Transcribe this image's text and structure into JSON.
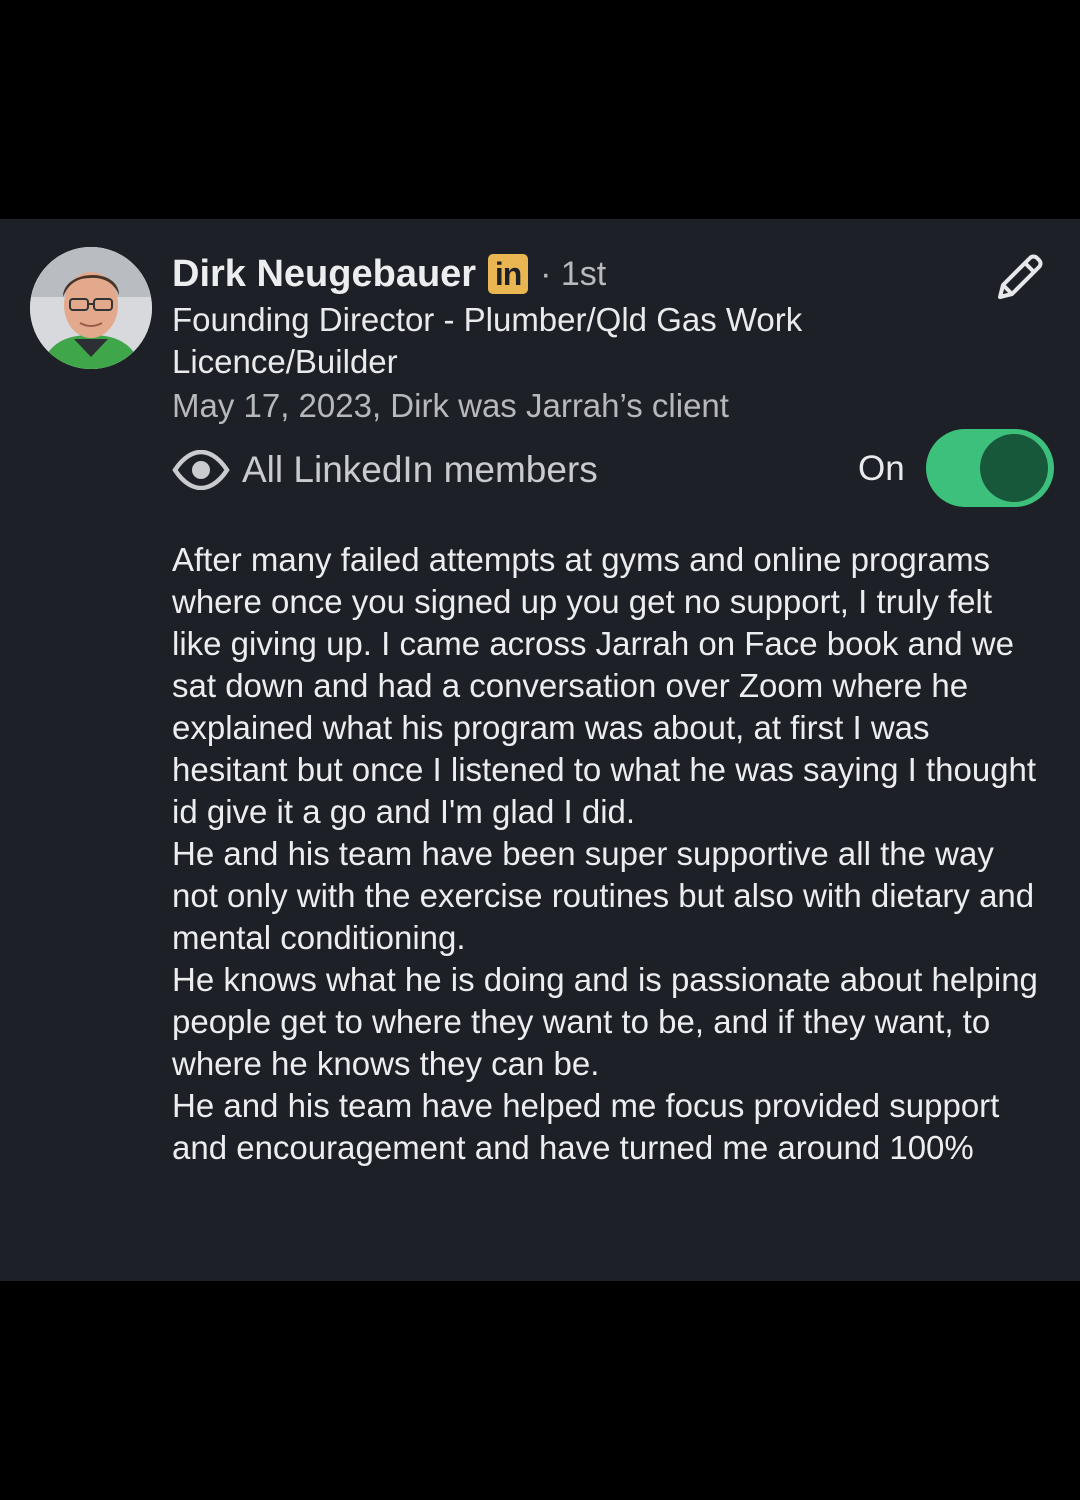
{
  "recommendation": {
    "author_name": "Dirk Neugebauer",
    "badge": "in",
    "connection_degree": "· 1st",
    "headline": "Founding Director - Plumber/Qld Gas Work Licence/Builder",
    "date_relation": "May 17, 2023, Dirk was Jarrah’s client",
    "visibility_label": "All LinkedIn members",
    "toggle_state_label": "On",
    "toggle_on": true,
    "text": "After many failed attempts at gyms and online programs where once you signed up you get no support, I truly felt like giving up. I came across Jarrah on Face book and we sat down and had a conversation over Zoom where he explained what his program was about, at first I was hesitant but once I listened to what he was saying I thought id give it a go and I'm glad I did.\nHe and his team have been super supportive all the way not only with the exercise routines but also with dietary and mental conditioning.\nHe knows what he is doing and is passionate about helping people get to where they want to be, and if they want, to where he knows they can be.\nHe and his team have helped me focus provided support and encouragement and have turned me around 100%"
  },
  "icons": {
    "edit": "pencil-icon",
    "visibility": "eye-icon",
    "avatar": "avatar"
  },
  "colors": {
    "background": "#000000",
    "card": "#1d2026",
    "toggle_track": "#3dc07b",
    "toggle_knob": "#17583a",
    "linkedin_badge": "#e9b651"
  }
}
